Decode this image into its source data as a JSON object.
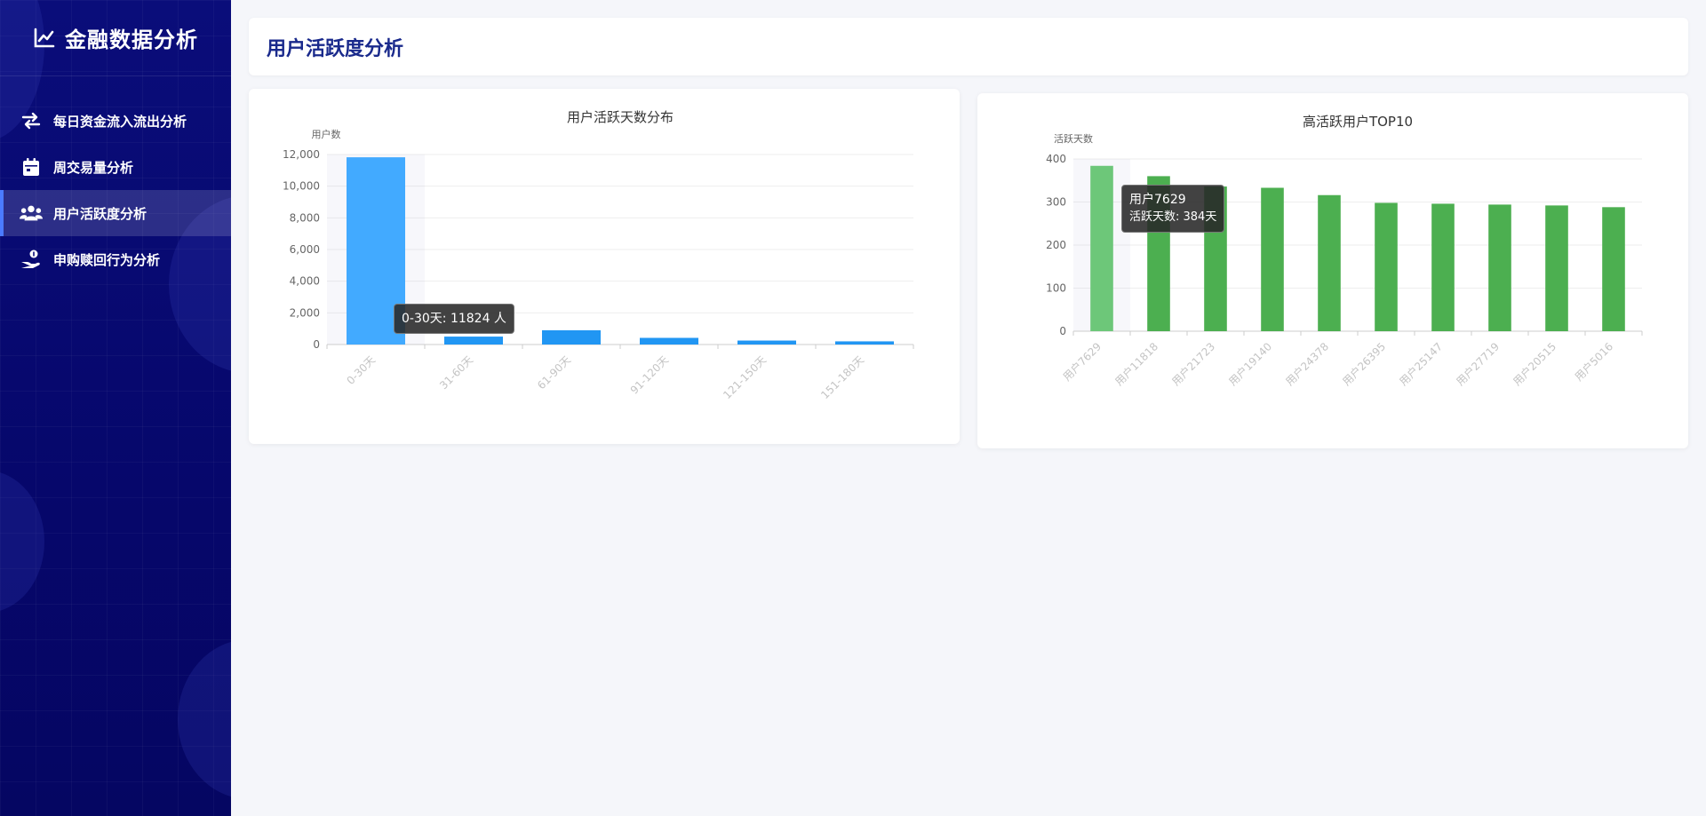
{
  "sidebar": {
    "brand_title": "金融数据分析",
    "items": [
      {
        "label": "每日资金流入流出分析",
        "icon": "exchange-icon",
        "active": false
      },
      {
        "label": "周交易量分析",
        "icon": "calendar-icon",
        "active": false
      },
      {
        "label": "用户活跃度分析",
        "icon": "users-icon",
        "active": true
      },
      {
        "label": "申购赎回行为分析",
        "icon": "hand-coin-icon",
        "active": false
      }
    ]
  },
  "header": {
    "title": "用户活跃度分析"
  },
  "chart_data": [
    {
      "type": "bar",
      "title": "用户活跃天数分布",
      "ylabel": "用户数",
      "categories": [
        "0-30天",
        "31-60天",
        "61-90天",
        "91-120天",
        "121-150天",
        "151-180天"
      ],
      "values": [
        11824,
        500,
        900,
        420,
        250,
        200
      ],
      "ylim": [
        0,
        12000
      ],
      "yticks": [
        "0",
        "2,000",
        "4,000",
        "6,000",
        "8,000",
        "10,000",
        "12,000"
      ],
      "color": "#2196f3",
      "highlight_color": "#42aaff",
      "tooltip": {
        "text": "0-30天: 11824 人"
      }
    },
    {
      "type": "bar",
      "title": "高活跃用户TOP10",
      "ylabel": "活跃天数",
      "categories": [
        "用户7629",
        "用户11818",
        "用户21723",
        "用户19140",
        "用户24378",
        "用户26395",
        "用户25147",
        "用户27719",
        "用户20515",
        "用户5016"
      ],
      "values": [
        384,
        360,
        336,
        333,
        316,
        298,
        296,
        294,
        292,
        288
      ],
      "ylim": [
        0,
        400
      ],
      "yticks": [
        "0",
        "100",
        "200",
        "300",
        "400"
      ],
      "color": "#4caf50",
      "highlight_color": "#6dc779",
      "tooltip": {
        "name": "用户7629",
        "label": "活跃天数: 384天"
      }
    }
  ]
}
